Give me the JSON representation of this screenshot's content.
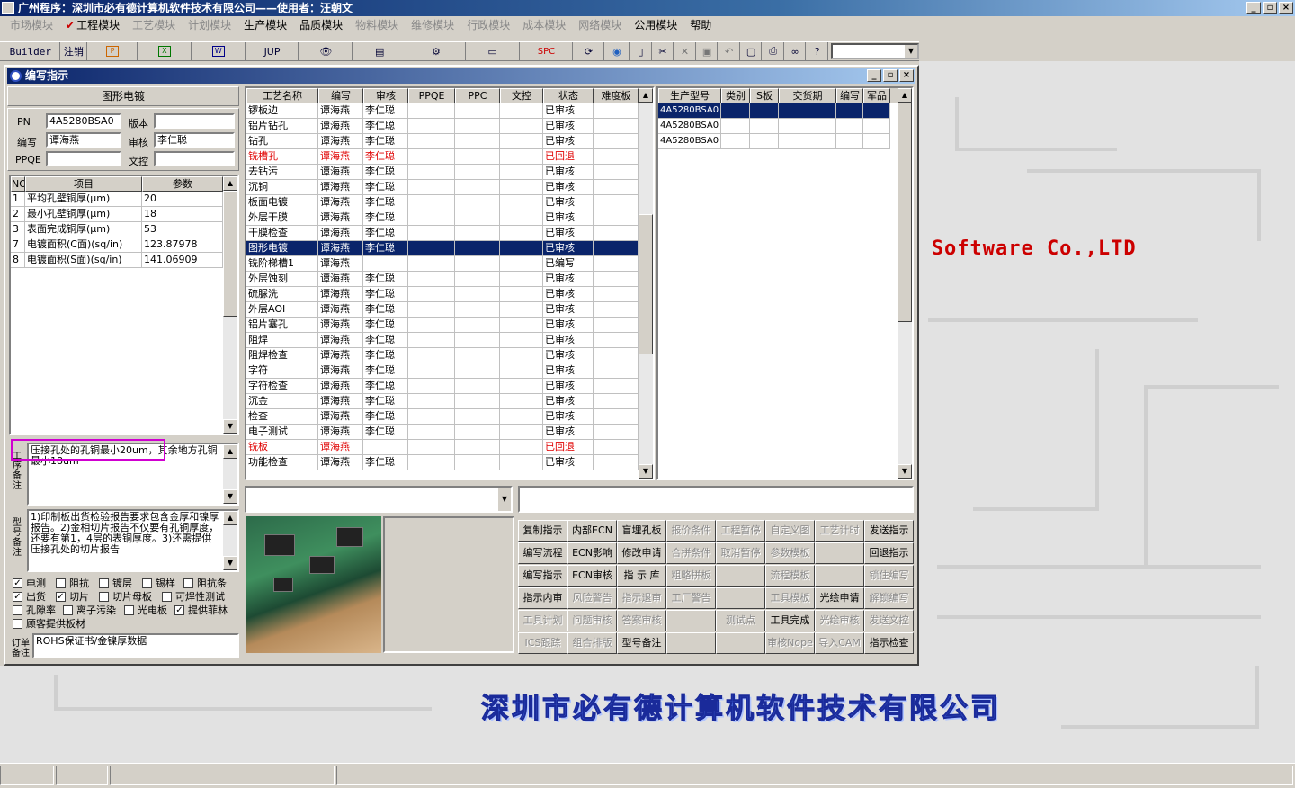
{
  "app": {
    "title": "广州程序：深圳市必有德计算机软件技术有限公司——使用者：汪朝文",
    "window_buttons": [
      "_",
      "▫",
      "×"
    ]
  },
  "menu": [
    {
      "label": "市场模块",
      "enabled": false
    },
    {
      "label": "工程模块",
      "enabled": true,
      "checked": true
    },
    {
      "label": "工艺模块",
      "enabled": false
    },
    {
      "label": "计划模块",
      "enabled": false
    },
    {
      "label": "生产模块",
      "enabled": true
    },
    {
      "label": "品质模块",
      "enabled": true
    },
    {
      "label": "物料模块",
      "enabled": false
    },
    {
      "label": "维修模块",
      "enabled": false
    },
    {
      "label": "行政模块",
      "enabled": false
    },
    {
      "label": "成本模块",
      "enabled": false
    },
    {
      "label": "网络模块",
      "enabled": false
    },
    {
      "label": "公用模块",
      "enabled": true
    },
    {
      "label": "帮助",
      "enabled": true
    }
  ],
  "toolbar": {
    "builder": "Builder",
    "logout": "注销",
    "jup": "JUP",
    "spc": "SPC"
  },
  "brand": {
    "en": "er Software Co.,LTD",
    "cn": "深圳市必有德计算机软件技术有限公司"
  },
  "dialog": {
    "title": "编写指示",
    "section_title": "图形电镀",
    "pn_label": "PN",
    "pn_value": "4A5280BSA0",
    "version_label": "版本",
    "version_value": "",
    "writer_label": "编写",
    "writer_value": "谭海燕",
    "reviewer_label": "审核",
    "reviewer_value": "李仁聪",
    "ppqe_label": "PPQE",
    "ppqe_value": "",
    "doc_label": "文控",
    "doc_value": "",
    "params": {
      "headers": [
        "NO",
        "项目",
        "参数"
      ],
      "rows": [
        [
          "1",
          "平均孔壁铜厚(μm)",
          "20"
        ],
        [
          "2",
          "最小孔壁铜厚(μm)",
          "18"
        ],
        [
          "3",
          "表面完成铜厚(μm)",
          "53"
        ],
        [
          "7",
          "电镀面积(C面)(sq/in)",
          "123.87978"
        ],
        [
          "8",
          "电镀面积(S面)(sq/in)",
          "141.06909"
        ]
      ]
    },
    "process_note_label": "工序备注",
    "process_note": "压接孔处的孔铜最小20um，其余地方孔铜最小18um",
    "model_note_label": "型号备注",
    "model_note": "1)印制板出货检验报告要求包含金厚和镍厚报告。2)金相切片报告不仅要有孔铜厚度，还要有第1，4层的表铜厚度。3)还需提供压接孔处的切片报告",
    "checkboxes": [
      {
        "label": "电测",
        "checked": true
      },
      {
        "label": "阻抗",
        "checked": false
      },
      {
        "label": "镀层",
        "checked": false
      },
      {
        "label": "锡样",
        "checked": false
      },
      {
        "label": "阻抗条",
        "checked": false
      },
      {
        "label": "出货",
        "checked": true
      },
      {
        "label": "切片",
        "checked": true
      },
      {
        "label": "切片母板",
        "checked": false
      },
      {
        "label": "可焊性测试",
        "checked": false
      },
      {
        "label": "孔隙率",
        "checked": false
      },
      {
        "label": "离子污染",
        "checked": false
      },
      {
        "label": "光电板",
        "checked": false
      },
      {
        "label": "提供菲林",
        "checked": true
      },
      {
        "label": "顾客提供板材",
        "checked": false
      }
    ],
    "order_note_label": "订单备注",
    "order_note": "ROHS保证书/金镍厚数据",
    "process_grid": {
      "headers": [
        "工艺名称",
        "编写",
        "审核",
        "PPQE",
        "PPC",
        "文控",
        "状态",
        "难度板"
      ],
      "rows": [
        {
          "name": "锣板边",
          "writer": "谭海燕",
          "reviewer": "李仁聪",
          "status": "已审核",
          "state": "normal"
        },
        {
          "name": "铝片钻孔",
          "writer": "谭海燕",
          "reviewer": "李仁聪",
          "status": "已审核",
          "state": "normal"
        },
        {
          "name": "钻孔",
          "writer": "谭海燕",
          "reviewer": "李仁聪",
          "status": "已审核",
          "state": "normal"
        },
        {
          "name": "铣槽孔",
          "writer": "谭海燕",
          "reviewer": "李仁聪",
          "status": "已回退",
          "state": "red"
        },
        {
          "name": "去钻污",
          "writer": "谭海燕",
          "reviewer": "李仁聪",
          "status": "已审核",
          "state": "normal"
        },
        {
          "name": "沉铜",
          "writer": "谭海燕",
          "reviewer": "李仁聪",
          "status": "已审核",
          "state": "normal"
        },
        {
          "name": "板面电镀",
          "writer": "谭海燕",
          "reviewer": "李仁聪",
          "status": "已审核",
          "state": "normal"
        },
        {
          "name": "外层干膜",
          "writer": "谭海燕",
          "reviewer": "李仁聪",
          "status": "已审核",
          "state": "normal"
        },
        {
          "name": "干膜检查",
          "writer": "谭海燕",
          "reviewer": "李仁聪",
          "status": "已审核",
          "state": "normal"
        },
        {
          "name": "图形电镀",
          "writer": "谭海燕",
          "reviewer": "李仁聪",
          "status": "已审核",
          "state": "selected"
        },
        {
          "name": "铣阶梯槽1",
          "writer": "谭海燕",
          "reviewer": "",
          "status": "已编写",
          "state": "normal"
        },
        {
          "name": "外层蚀刻",
          "writer": "谭海燕",
          "reviewer": "李仁聪",
          "status": "已审核",
          "state": "normal"
        },
        {
          "name": "硫脲洗",
          "writer": "谭海燕",
          "reviewer": "李仁聪",
          "status": "已审核",
          "state": "normal"
        },
        {
          "name": "外层AOI",
          "writer": "谭海燕",
          "reviewer": "李仁聪",
          "status": "已审核",
          "state": "normal"
        },
        {
          "name": "铝片塞孔",
          "writer": "谭海燕",
          "reviewer": "李仁聪",
          "status": "已审核",
          "state": "normal"
        },
        {
          "name": "阻焊",
          "writer": "谭海燕",
          "reviewer": "李仁聪",
          "status": "已审核",
          "state": "normal"
        },
        {
          "name": "阻焊检查",
          "writer": "谭海燕",
          "reviewer": "李仁聪",
          "status": "已审核",
          "state": "normal"
        },
        {
          "name": "字符",
          "writer": "谭海燕",
          "reviewer": "李仁聪",
          "status": "已审核",
          "state": "normal"
        },
        {
          "name": "字符检查",
          "writer": "谭海燕",
          "reviewer": "李仁聪",
          "status": "已审核",
          "state": "normal"
        },
        {
          "name": "沉金",
          "writer": "谭海燕",
          "reviewer": "李仁聪",
          "status": "已审核",
          "state": "normal"
        },
        {
          "name": "检查",
          "writer": "谭海燕",
          "reviewer": "李仁聪",
          "status": "已审核",
          "state": "normal"
        },
        {
          "name": "电子测试",
          "writer": "谭海燕",
          "reviewer": "李仁聪",
          "status": "已审核",
          "state": "normal"
        },
        {
          "name": "铣板",
          "writer": "谭海燕",
          "reviewer": "",
          "status": "已回退",
          "state": "red"
        },
        {
          "name": "功能检查",
          "writer": "谭海燕",
          "reviewer": "李仁聪",
          "status": "已审核",
          "state": "normal"
        }
      ]
    },
    "model_grid": {
      "headers": [
        "生产型号",
        "类别",
        "S板",
        "交货期",
        "编写",
        "军品"
      ],
      "rows": [
        {
          "model": "4A5280BSA0",
          "selected": true
        },
        {
          "model": "4A5280BSA0",
          "selected": false
        },
        {
          "model": "4A5280BSA0",
          "selected": false
        }
      ]
    },
    "buttons": [
      [
        {
          "label": "复制指示",
          "enabled": true
        },
        {
          "label": "内部ECN",
          "enabled": true
        },
        {
          "label": "盲埋孔板",
          "enabled": true
        },
        {
          "label": "报价条件",
          "enabled": false
        },
        {
          "label": "工程暂停",
          "enabled": false
        },
        {
          "label": "自定义图",
          "enabled": false
        },
        {
          "label": "工艺计时",
          "enabled": false
        },
        {
          "label": "发送指示",
          "enabled": true
        }
      ],
      [
        {
          "label": "编写流程",
          "enabled": true
        },
        {
          "label": "ECN影响",
          "enabled": true
        },
        {
          "label": "修改申请",
          "enabled": true
        },
        {
          "label": "合拼条件",
          "enabled": false
        },
        {
          "label": "取消暂停",
          "enabled": false
        },
        {
          "label": "参数模板",
          "enabled": false
        },
        {
          "label": "",
          "enabled": false
        },
        {
          "label": "回退指示",
          "enabled": true
        }
      ],
      [
        {
          "label": "编写指示",
          "enabled": true
        },
        {
          "label": "ECN审核",
          "enabled": true
        },
        {
          "label": "指 示 库",
          "enabled": true
        },
        {
          "label": "粗略拼板",
          "enabled": false
        },
        {
          "label": "",
          "enabled": false
        },
        {
          "label": "流程模板",
          "enabled": false
        },
        {
          "label": "",
          "enabled": false
        },
        {
          "label": "锁住编写",
          "enabled": false
        }
      ],
      [
        {
          "label": "指示内审",
          "enabled": true
        },
        {
          "label": "风险警告",
          "enabled": false
        },
        {
          "label": "指示退审",
          "enabled": false
        },
        {
          "label": "工厂警告",
          "enabled": false
        },
        {
          "label": "",
          "enabled": false
        },
        {
          "label": "工具模板",
          "enabled": false
        },
        {
          "label": "光绘申请",
          "enabled": true
        },
        {
          "label": "解锁编写",
          "enabled": false
        }
      ],
      [
        {
          "label": "工具计划",
          "enabled": false
        },
        {
          "label": "问题审核",
          "enabled": false
        },
        {
          "label": "答案审核",
          "enabled": false
        },
        {
          "label": "",
          "enabled": false
        },
        {
          "label": "测试点",
          "enabled": false
        },
        {
          "label": "工具完成",
          "enabled": true
        },
        {
          "label": "光绘审核",
          "enabled": false
        },
        {
          "label": "发送文控",
          "enabled": false
        }
      ],
      [
        {
          "label": "ICS跟踪",
          "enabled": false
        },
        {
          "label": "组合排版",
          "enabled": false
        },
        {
          "label": "型号备注",
          "enabled": true
        },
        {
          "label": "",
          "enabled": false
        },
        {
          "label": "",
          "enabled": false
        },
        {
          "label": "审核Nope",
          "enabled": false
        },
        {
          "label": "导入CAM",
          "enabled": false
        },
        {
          "label": "指示检查",
          "enabled": true
        }
      ]
    ]
  },
  "colors": {
    "titlebar": "#0a246a",
    "selection": "#0a246a",
    "alert_red": "#e00000",
    "brand_red": "#cc0000",
    "brand_blue": "#3a5acf",
    "highlight_box": "#d000d0"
  }
}
